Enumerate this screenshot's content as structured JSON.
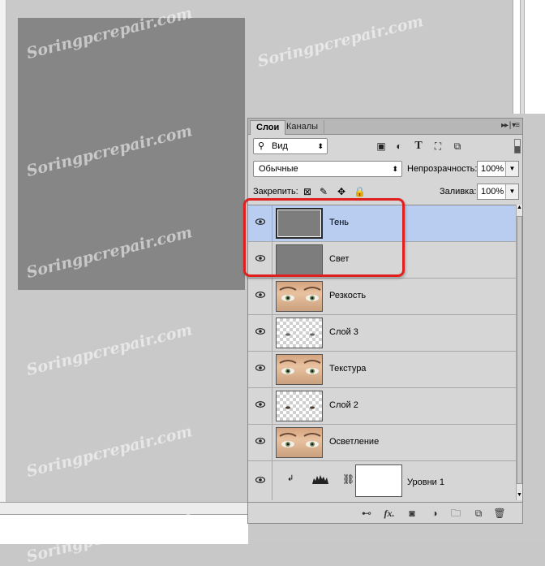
{
  "watermark": "Soringpcrepair.com",
  "panel": {
    "tabs": [
      {
        "label": "Слои",
        "active": true
      },
      {
        "label": "Каналы",
        "active": false
      }
    ],
    "menu_icon": "panel-menu-icon",
    "filter": {
      "label": "Вид",
      "icons": [
        "image-filter-icon",
        "adjustment-filter-icon",
        "type-filter-icon",
        "shape-filter-icon",
        "smart-object-filter-icon"
      ]
    },
    "blend_mode": "Обычные",
    "opacity_label": "Непрозрачность:",
    "opacity_value": "100%",
    "lock_label": "Закрепить:",
    "lock_icons": [
      "lock-transparent-icon",
      "lock-brush-icon",
      "lock-move-icon",
      "lock-all-icon"
    ],
    "fill_label": "Заливка:",
    "fill_value": "100%",
    "layers": [
      {
        "name": "Тень",
        "thumb": "gray",
        "selected": true,
        "visible": true
      },
      {
        "name": "Свет",
        "thumb": "gray",
        "selected": false,
        "visible": true
      },
      {
        "name": "Резкость",
        "thumb": "face",
        "selected": false,
        "visible": true
      },
      {
        "name": "Слой 3",
        "thumb": "checker-eyes",
        "selected": false,
        "visible": true
      },
      {
        "name": "Текстура",
        "thumb": "face",
        "selected": false,
        "visible": true
      },
      {
        "name": "Слой 2",
        "thumb": "checker-eyes",
        "selected": false,
        "visible": true
      },
      {
        "name": "Осветление",
        "thumb": "face",
        "selected": false,
        "visible": true
      },
      {
        "name": "Уровни 1",
        "thumb": "adjustment",
        "selected": false,
        "visible": true
      }
    ],
    "footer_icons": [
      "link-layers-icon",
      "fx-icon",
      "add-mask-icon",
      "new-adjustment-icon",
      "new-group-icon",
      "new-layer-icon",
      "delete-layer-icon"
    ],
    "fx_label": "fx."
  },
  "colors": {
    "highlight": "#e0201f",
    "selection": "#b8cdf0",
    "canvas": "#868686"
  }
}
